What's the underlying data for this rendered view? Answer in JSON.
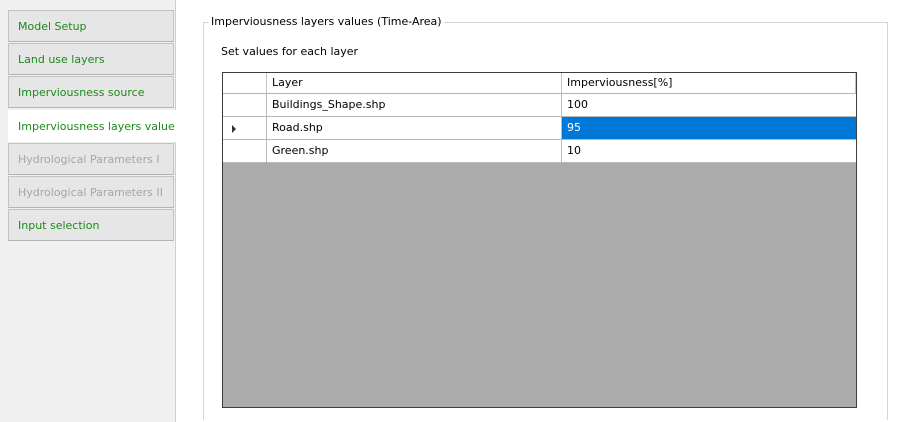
{
  "sidebar": {
    "items": [
      {
        "label": "Model Setup",
        "state": "enabled"
      },
      {
        "label": "Land use layers",
        "state": "enabled"
      },
      {
        "label": "Imperviousness source",
        "state": "enabled"
      },
      {
        "label": "Imperviousness layers values",
        "state": "active"
      },
      {
        "label": "Hydrological Parameters I",
        "state": "disabled"
      },
      {
        "label": "Hydrological Parameters II",
        "state": "disabled"
      },
      {
        "label": "Input selection",
        "state": "enabled"
      }
    ]
  },
  "group": {
    "title": "Imperviousness layers values (Time-Area)",
    "instruction": "Set values for each layer"
  },
  "grid": {
    "columns": [
      "Layer",
      "Imperviousness[%]"
    ],
    "rows": [
      {
        "layer": "Buildings_Shape.shp",
        "value": "100"
      },
      {
        "layer": "Road.shp",
        "value": "95"
      },
      {
        "layer": "Green.shp",
        "value": "10"
      }
    ]
  },
  "icons": {
    "current_row": "row-pointer-icon"
  },
  "colors": {
    "nav_enabled_text": "#1a8a1a",
    "nav_disabled_text": "#a6a6a6",
    "selection": "#0078d7",
    "grid_background": "#ababab"
  }
}
